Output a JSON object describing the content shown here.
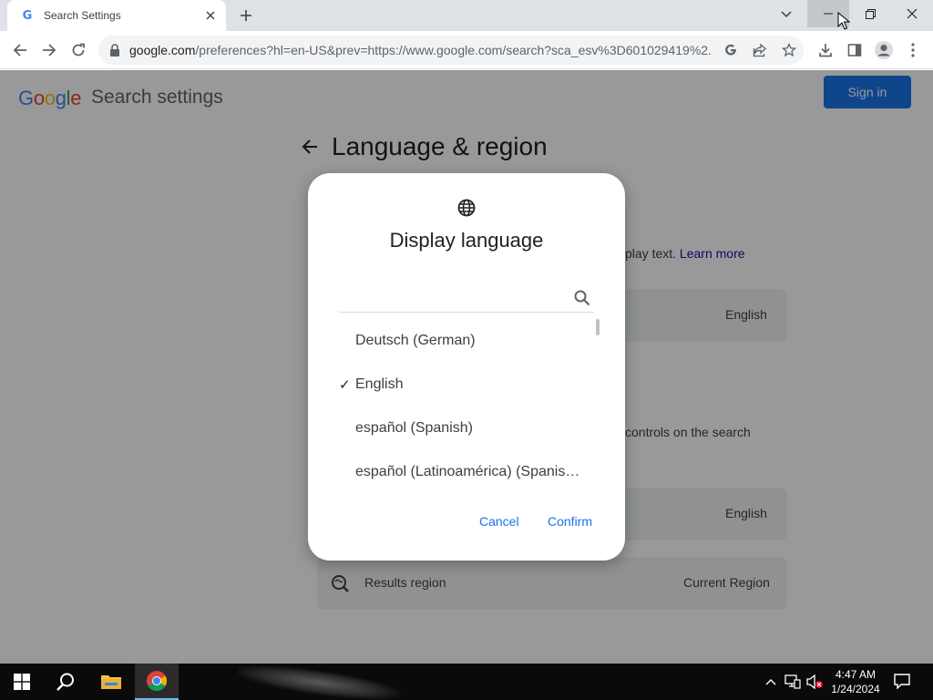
{
  "browser": {
    "tab": {
      "title": "Search Settings",
      "favicon": "G"
    },
    "url": {
      "host": "google.com",
      "path": "/preferences?hl=en-US&prev=https://www.google.com/search?sca_esv%3D601029419%2..."
    },
    "icons": [
      "back-icon",
      "forward-icon",
      "reload-icon",
      "lock-icon",
      "google-lens-icon",
      "share-icon",
      "bookmark-star-icon",
      "download-icon",
      "side-panel-icon",
      "profile-icon",
      "menu-icon"
    ]
  },
  "page": {
    "logo_letters": [
      {
        "ch": "G",
        "color": "#4285f4"
      },
      {
        "ch": "o",
        "color": "#ea4335"
      },
      {
        "ch": "o",
        "color": "#fbbc05"
      },
      {
        "ch": "g",
        "color": "#4285f4"
      },
      {
        "ch": "l",
        "color": "#34a853"
      },
      {
        "ch": "e",
        "color": "#ea4335"
      }
    ],
    "title": "Search settings",
    "signin_label": "Sign in",
    "section_title": "Language & region",
    "display_text_fragment": "play text.",
    "learn_more": "Learn more",
    "display_lang_value": "English",
    "controls_fragment": "controls on the search",
    "search_lang_value": "English",
    "results_region_label": "Results region",
    "results_region_value": "Current Region"
  },
  "dialog": {
    "title": "Display language",
    "search_placeholder": "",
    "languages": [
      {
        "label": "Deutsch  (German)",
        "selected": false
      },
      {
        "label": "English",
        "selected": true
      },
      {
        "label": "español  (Spanish)",
        "selected": false
      },
      {
        "label": "español (Latinoamérica)  (Spanish (Latin America))",
        "selected": false
      }
    ],
    "check_mark": "✓",
    "cancel_label": "Cancel",
    "confirm_label": "Confirm"
  },
  "taskbar": {
    "time": "4:47 AM",
    "date": "1/24/2024"
  },
  "colors": {
    "accent": "#1a73e8",
    "signin_bg": "#1a73e8"
  }
}
